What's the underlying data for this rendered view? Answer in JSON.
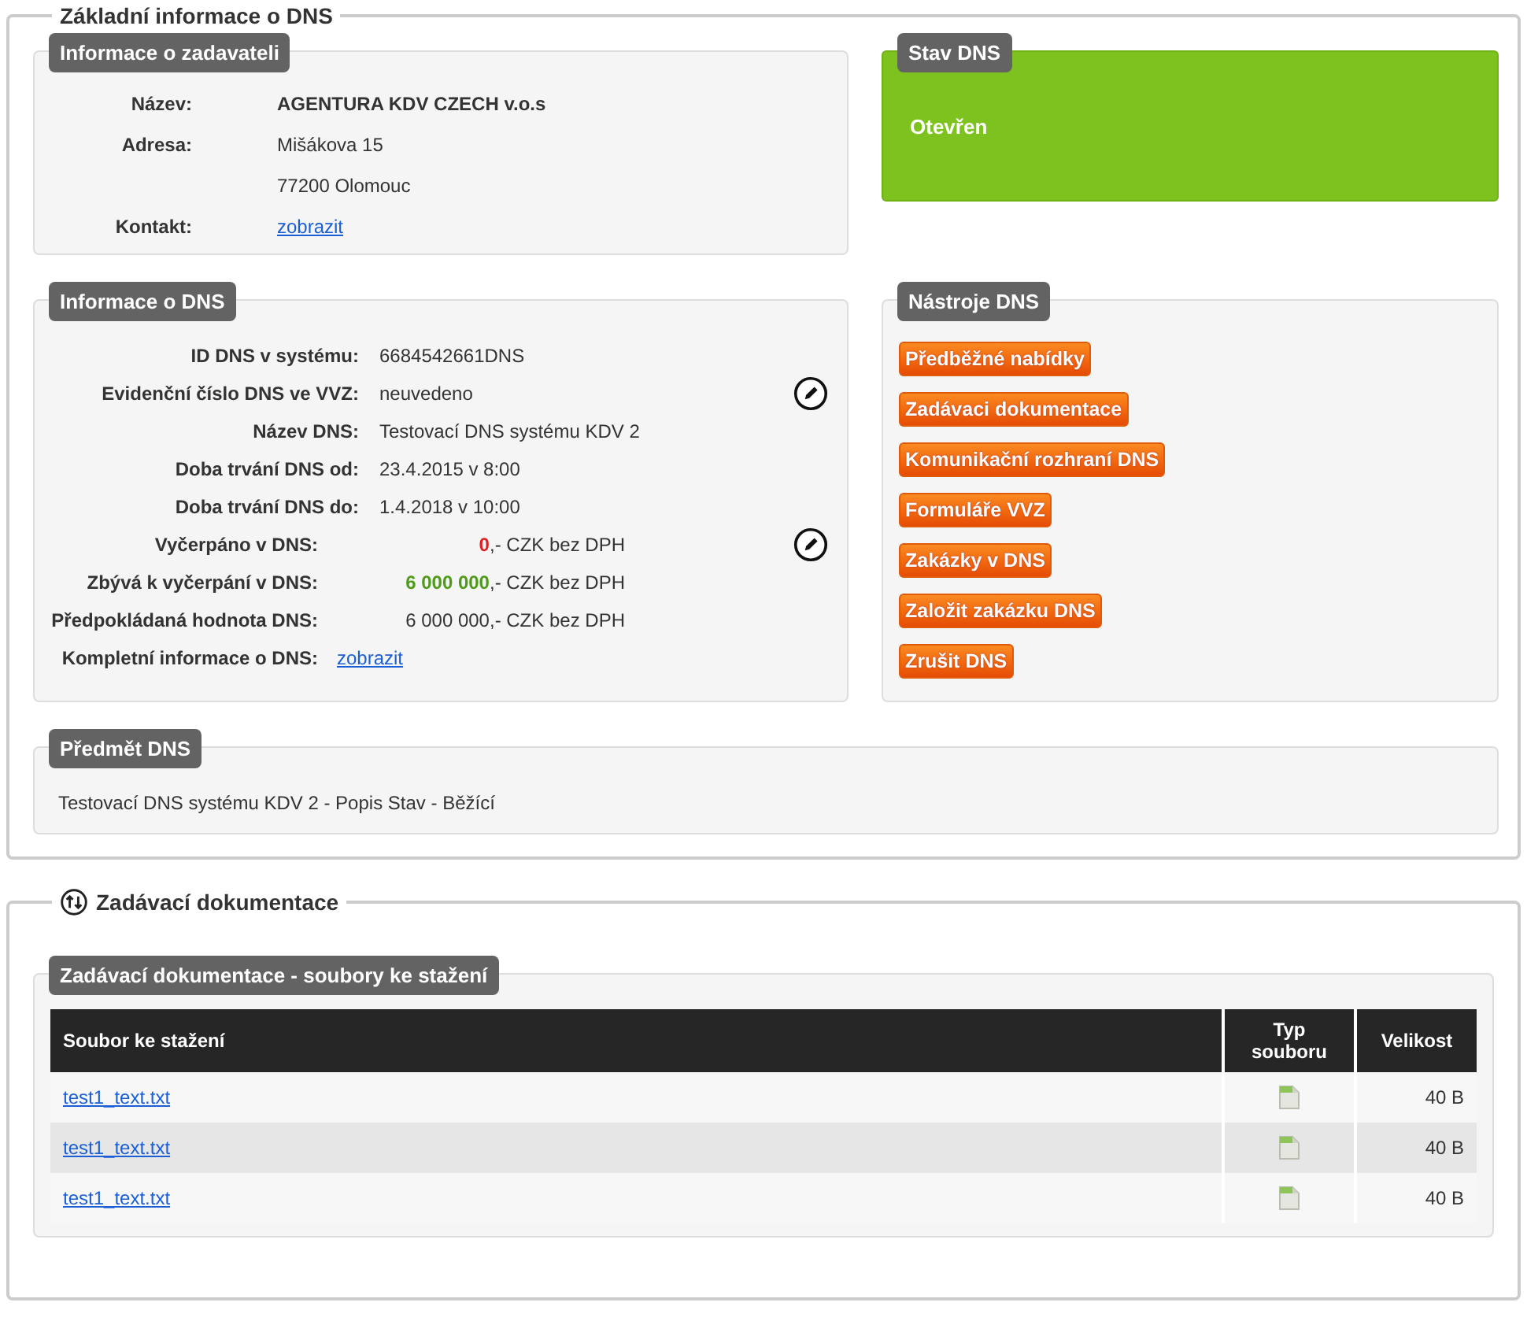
{
  "main_section": {
    "title": "Základní informace o DNS"
  },
  "submitter": {
    "title": "Informace o zadavateli",
    "rows": [
      {
        "label": "Název:",
        "kind": "bold",
        "lines": [
          "AGENTURA KDV CZECH v.o.s"
        ]
      },
      {
        "label": "Adresa:",
        "kind": "text",
        "lines": [
          "Mišákova 15",
          "77200 Olomouc"
        ]
      },
      {
        "label": "Kontakt:",
        "kind": "link",
        "lines": [
          "zobrazit"
        ]
      }
    ]
  },
  "status": {
    "title": "Stav DNS",
    "value": "Otevřen",
    "color": "#7dc21e"
  },
  "dns_info": {
    "title": "Informace o DNS",
    "rows": [
      {
        "label": "ID DNS v systému:",
        "kind": "text",
        "value": "6684542661DNS",
        "editable": false
      },
      {
        "label": "Evidenční číslo DNS ve VVZ:",
        "kind": "text",
        "value": "neuvedeno",
        "editable": true
      },
      {
        "label": "Název DNS:",
        "kind": "text",
        "value": "Testovací DNS systému KDV 2",
        "editable": false
      },
      {
        "label": "Doba trvání DNS od:",
        "kind": "text",
        "value": "23.4.2015 v 8:00",
        "editable": false
      },
      {
        "label": "Doba trvání DNS do:",
        "kind": "text",
        "value": "1.4.2018 v 10:00",
        "editable": false
      },
      {
        "label": "Vyčerpáno v DNS:",
        "kind": "money",
        "value": "**0**,- CZK bez DPH",
        "color": "#e02020",
        "editable": true
      },
      {
        "label": "Zbývá k vyčerpání v DNS:",
        "kind": "money",
        "value": "**6 000 000**,- CZK bez DPH",
        "color": "#4f9a1a",
        "editable": false
      },
      {
        "label": "Předpokládaná hodnota DNS:",
        "kind": "money",
        "value": "6 000 000,- CZK bez DPH",
        "editable": false
      },
      {
        "label": "Kompletní informace o DNS:",
        "kind": "link",
        "value": "zobrazit",
        "editable": false
      }
    ]
  },
  "tools": {
    "title": "Nástroje DNS",
    "buttons": [
      "Předběžné nabídky",
      "Zadávaci dokumentace",
      "Komunikační rozhraní DNS",
      "Formuláře VVZ",
      "Zakázky v DNS",
      "Založit zakázku DNS",
      "Zrušit DNS"
    ]
  },
  "subject": {
    "title": "Předmět DNS",
    "text": "Testovací DNS systému KDV 2 - Popis Stav - Běžící"
  },
  "docs_section": {
    "title": "Zadávací dokumentace"
  },
  "docs": {
    "title": "Zadávací dokumentace - soubory ke stažení",
    "columns": [
      "Soubor ke stažení",
      "Typ souboru",
      "Velikost"
    ],
    "rows": [
      {
        "file": "test1_text.txt",
        "size": "40 B"
      },
      {
        "file": "test1_text.txt",
        "size": "40 B"
      },
      {
        "file": "test1_text.txt",
        "size": "40 B"
      }
    ]
  }
}
